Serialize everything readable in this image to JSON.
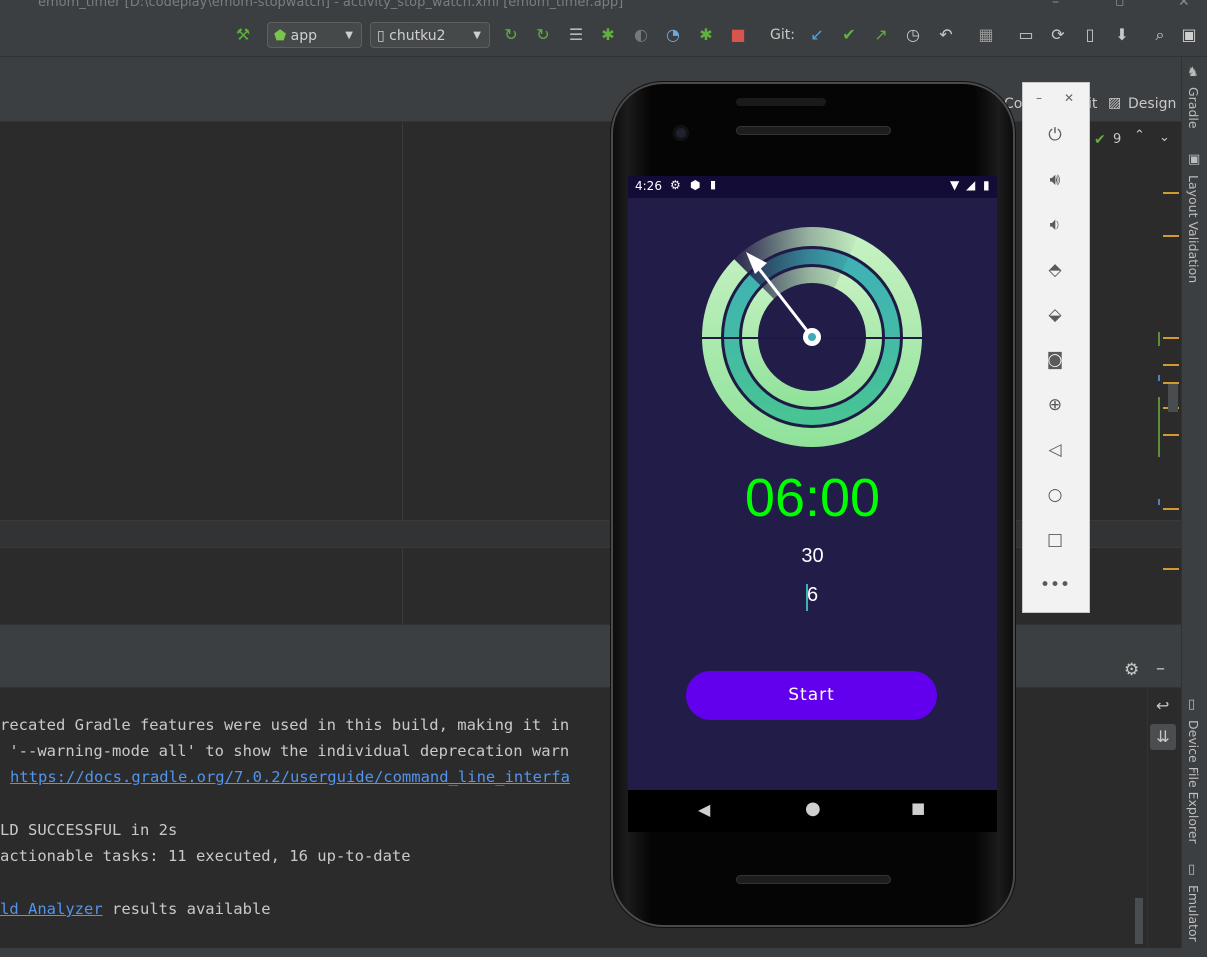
{
  "window": {
    "title": "emom_timer [D:\\codeplay\\emom-stopwatch] - activity_stop_watch.xml [emom_timer.app]"
  },
  "toolbar": {
    "run_config": "app",
    "device": "chutku2",
    "git_label": "Git:"
  },
  "editor_header": {
    "code_label": "Co",
    "split_label": "it",
    "design_label": "Design",
    "inspection_count": "9"
  },
  "console": {
    "lines": [
      "recated Gradle features were used in this build, making it in",
      " '--warning-mode all' to show the individual deprecation warn",
      "",
      "",
      "LD SUCCESSFUL in 2s",
      "actionable tasks: 11 executed, 16 up-to-date",
      "",
      ""
    ],
    "link_url": "https://docs.gradle.org/7.0.2/userguide/command_line_interfa",
    "analyzer_link": "ld Analyzer",
    "analyzer_rest": " results available"
  },
  "right_tools": {
    "gradle": "Gradle",
    "layout_validation": "Layout Validation",
    "device_file_explorer": "Device File Explorer",
    "emulator": "Emulator"
  },
  "phone": {
    "status_time": "4:26",
    "timer_display": "06:00",
    "interval_value": "30",
    "rounds_value": "6",
    "start_button": "Start",
    "colors": {
      "screen_bg": "#221c48",
      "timer_green": "#00ff00",
      "button_purple": "#6200ee"
    }
  },
  "colors": {
    "ide_bg": "#2b2b2b",
    "ide_panel": "#3c3f41",
    "link": "#5394ec",
    "marker": "#d19a30"
  }
}
